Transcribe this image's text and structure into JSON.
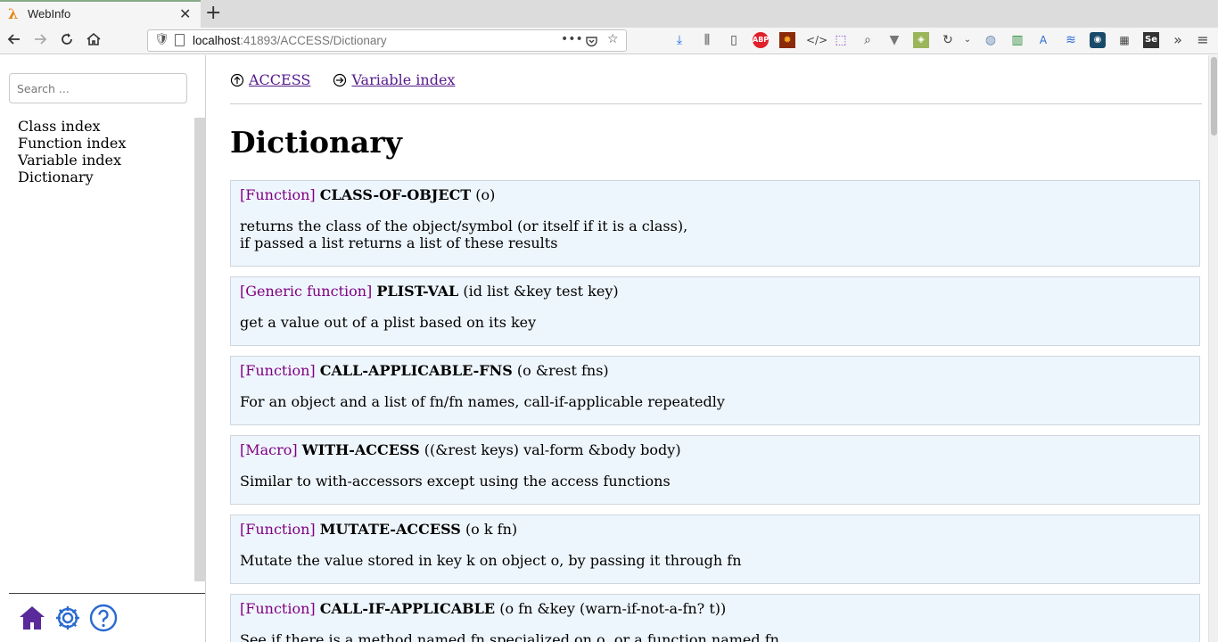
{
  "browser": {
    "tab_title": "WebInfo",
    "tab_icon": "lambda-icon",
    "url_host": "localhost",
    "url_rest": ":41893/ACCESS/Dictionary"
  },
  "sidebar": {
    "search_placeholder": "Search ...",
    "links": [
      "Class index",
      "Function index",
      "Variable index",
      "Dictionary"
    ],
    "bottom_icons": [
      "home-icon",
      "gear-icon",
      "help-icon"
    ]
  },
  "main": {
    "nav": [
      {
        "label": "ACCESS",
        "icon": "arrow-up-circle-icon"
      },
      {
        "label": "Variable index",
        "icon": "arrow-right-circle-icon"
      }
    ],
    "title": "Dictionary",
    "entries": [
      {
        "kind": "[Function]",
        "name": "CLASS-OF-OBJECT",
        "args": "(o)",
        "desc": "returns the class of the object/symbol (or itself if it is a class),\nif passed a list returns a list of these results"
      },
      {
        "kind": "[Generic function]",
        "name": "PLIST-VAL",
        "args": "(id list &key test key)",
        "desc": "get a value out of a plist based on its key"
      },
      {
        "kind": "[Function]",
        "name": "CALL-APPLICABLE-FNS",
        "args": "(o &rest fns)",
        "desc": "For an object and a list of fn/fn names, call-if-applicable repeatedly"
      },
      {
        "kind": "[Macro]",
        "name": "WITH-ACCESS",
        "args": "((&rest keys) val-form &body body)",
        "desc": "Similar to with-accessors except using the access functions"
      },
      {
        "kind": "[Function]",
        "name": "MUTATE-ACCESS",
        "args": "(o k fn)",
        "desc": "Mutate the value stored in key k on object o, by passing it through fn"
      },
      {
        "kind": "[Function]",
        "name": "CALL-IF-APPLICABLE",
        "args": "(o fn &key (warn-if-not-a-fn? t))",
        "desc": "See if there is a method named fn specialized on o, or a function named fn"
      }
    ]
  },
  "colors": {
    "link": "#551a8b",
    "kind": "#800080",
    "entry_bg": "#eef6fd",
    "icon": "#5a2a9a"
  }
}
